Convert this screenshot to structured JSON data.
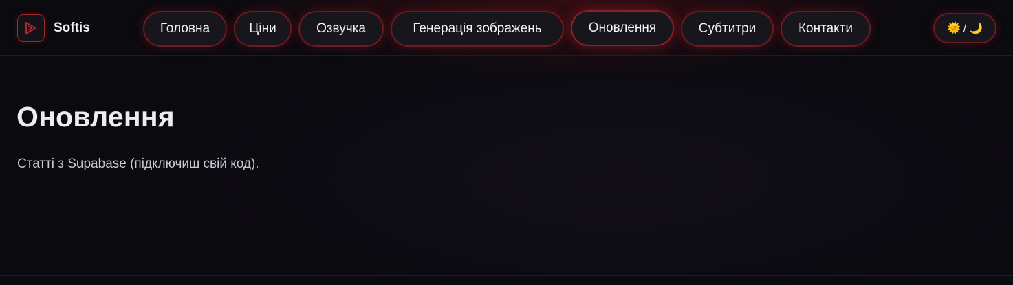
{
  "brand": {
    "name": "Softis",
    "logo_icon": "play-icon"
  },
  "nav": {
    "items": [
      {
        "label": "Головна"
      },
      {
        "label": "Ціни"
      },
      {
        "label": "Озвучка"
      },
      {
        "label": "Генерація зображень"
      },
      {
        "label": "Оновлення",
        "active": true
      },
      {
        "label": "Субтитри"
      },
      {
        "label": "Контакти"
      }
    ]
  },
  "theme_toggle": {
    "sun": "🌞",
    "separator": "/",
    "moon": "🌙"
  },
  "main": {
    "title": "Оновлення",
    "subtitle": "Статті з Supabase (підключиш свій код)."
  },
  "colors": {
    "background": "#0b0a0f",
    "accent": "#a5252c",
    "pill_background": "#17161c"
  }
}
